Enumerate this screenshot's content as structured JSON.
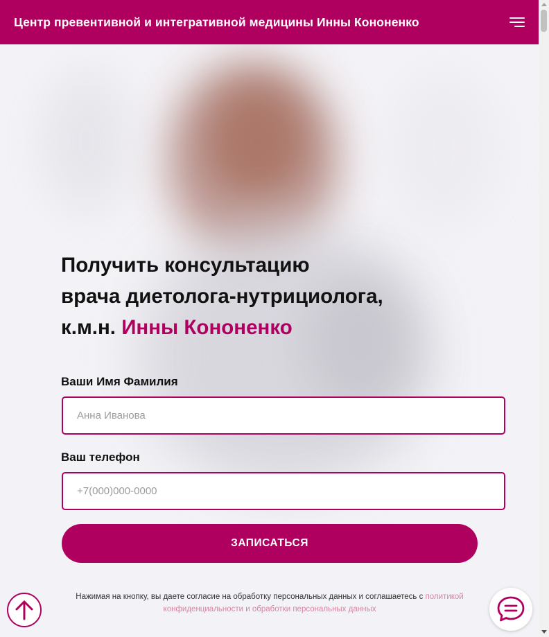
{
  "header": {
    "title": "Центр превентивной и интегративной медицины Инны Кононенко",
    "menu_icon": "hamburger-menu-icon"
  },
  "hero": {
    "title_line1": "Получить консультацию",
    "title_line2": "врача диетолога-нутрициолога,",
    "title_line3_prefix": "к.м.н. ",
    "title_line3_accent": "Инны Кононенко"
  },
  "form": {
    "name_label": "Ваши Имя Фамилия",
    "name_placeholder": "Анна Иванова",
    "name_value": "",
    "phone_label": "Ваш телефон",
    "phone_placeholder": "+7(000)000-0000",
    "phone_value": "",
    "submit_label": "ЗАПИСАТЬСЯ"
  },
  "consent": {
    "text": "Нажимая на кнопку, вы даете согласие на обработку персональных данных и соглашаетесь с ",
    "link_text": "политикой конфиденциальности и обработки персональных данных"
  },
  "floating": {
    "scroll_up_icon": "arrow-up-circle-icon",
    "chat_icon": "chat-bubble-icon"
  },
  "colors": {
    "brand": "#b0005f",
    "link": "#d9849e",
    "background": "#f3f2f6"
  }
}
